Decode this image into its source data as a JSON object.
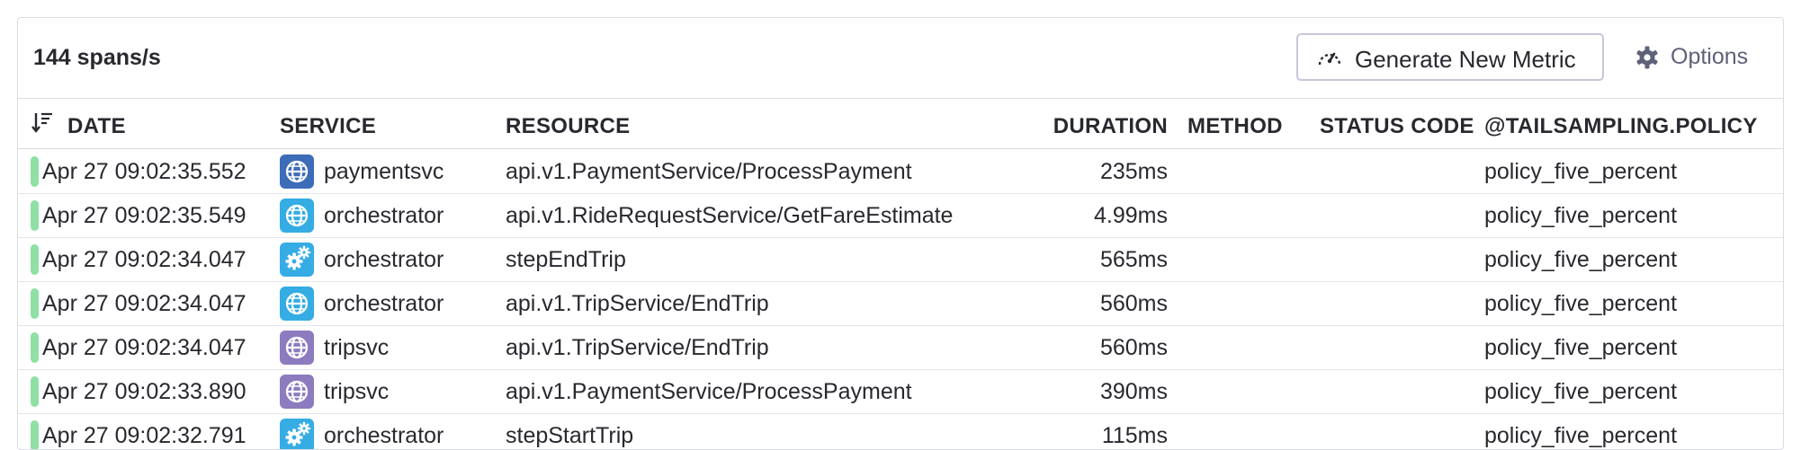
{
  "toolbar": {
    "rate_label": "144 spans/s",
    "generate_metric_label": "Generate New Metric",
    "options_label": "Options"
  },
  "table": {
    "columns": [
      {
        "key": "date",
        "label": "DATE"
      },
      {
        "key": "service",
        "label": "SERVICE"
      },
      {
        "key": "resource",
        "label": "RESOURCE"
      },
      {
        "key": "duration",
        "label": "DURATION"
      },
      {
        "key": "method",
        "label": "METHOD"
      },
      {
        "key": "status_code",
        "label": "STATUS CODE"
      },
      {
        "key": "policy",
        "label": "@TAILSAMPLING.POLICY"
      }
    ],
    "rows": [
      {
        "date": "Apr 27 09:02:35.552",
        "service": "paymentsvc",
        "service_icon": "globe-icon",
        "icon_color": "#3d6cb8",
        "resource": "api.v1.PaymentService/ProcessPayment",
        "duration": "235ms",
        "method": "",
        "status_code": "",
        "policy": "policy_five_percent",
        "status_color": "#8fe0a4"
      },
      {
        "date": "Apr 27 09:02:35.549",
        "service": "orchestrator",
        "service_icon": "globe-icon",
        "icon_color": "#35ace3",
        "resource": "api.v1.RideRequestService/GetFareEstimate",
        "duration": "4.99ms",
        "method": "",
        "status_code": "",
        "policy": "policy_five_percent",
        "status_color": "#8fe0a4"
      },
      {
        "date": "Apr 27 09:02:34.047",
        "service": "orchestrator",
        "service_icon": "gears-icon",
        "icon_color": "#35ace3",
        "resource": "stepEndTrip",
        "duration": "565ms",
        "method": "",
        "status_code": "",
        "policy": "policy_five_percent",
        "status_color": "#8fe0a4"
      },
      {
        "date": "Apr 27 09:02:34.047",
        "service": "orchestrator",
        "service_icon": "globe-icon",
        "icon_color": "#35ace3",
        "resource": "api.v1.TripService/EndTrip",
        "duration": "560ms",
        "method": "",
        "status_code": "",
        "policy": "policy_five_percent",
        "status_color": "#8fe0a4"
      },
      {
        "date": "Apr 27 09:02:34.047",
        "service": "tripsvc",
        "service_icon": "globe-icon",
        "icon_color": "#8c7bbf",
        "resource": "api.v1.TripService/EndTrip",
        "duration": "560ms",
        "method": "",
        "status_code": "",
        "policy": "policy_five_percent",
        "status_color": "#8fe0a4"
      },
      {
        "date": "Apr 27 09:02:33.890",
        "service": "tripsvc",
        "service_icon": "globe-icon",
        "icon_color": "#8c7bbf",
        "resource": "api.v1.PaymentService/ProcessPayment",
        "duration": "390ms",
        "method": "",
        "status_code": "",
        "policy": "policy_five_percent",
        "status_color": "#8fe0a4"
      },
      {
        "date": "Apr 27 09:02:32.791",
        "service": "orchestrator",
        "service_icon": "gears-icon",
        "icon_color": "#35ace3",
        "resource": "stepStartTrip",
        "duration": "115ms",
        "method": "",
        "status_code": "",
        "policy": "policy_five_percent",
        "status_color": "#8fe0a4"
      }
    ]
  }
}
